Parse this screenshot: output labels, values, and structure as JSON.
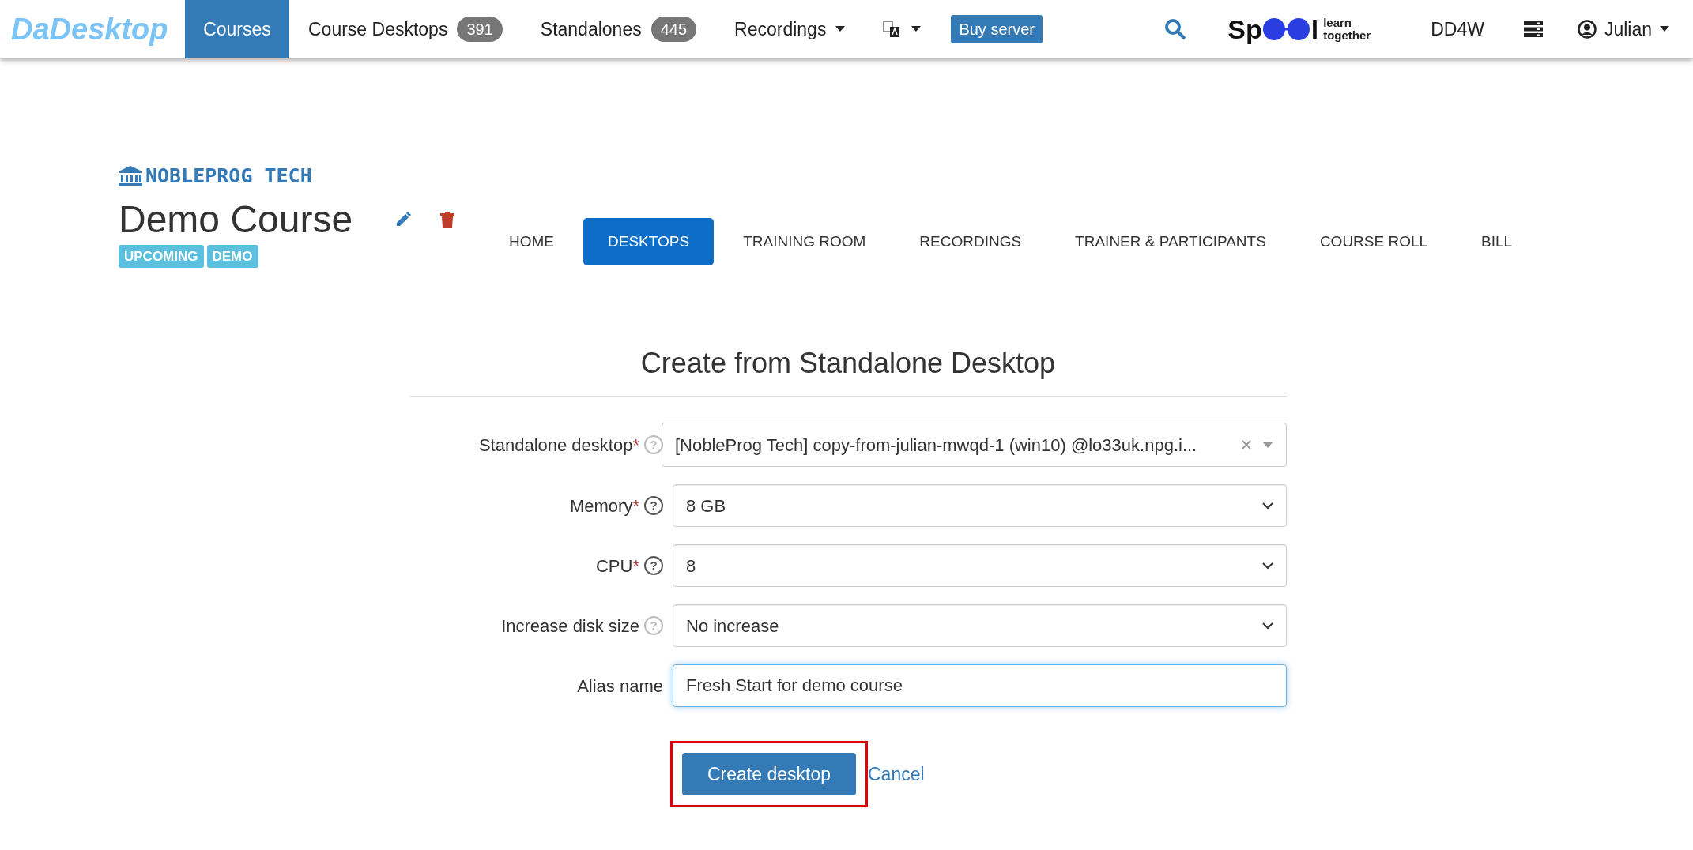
{
  "navbar": {
    "brand": "DaDesktop",
    "items": [
      {
        "kind": "link",
        "label": "Courses",
        "selected": true
      },
      {
        "kind": "link",
        "label": "Course Desktops",
        "badge": "391",
        "selected": false
      },
      {
        "kind": "link",
        "label": "Standalones",
        "badge": "445",
        "selected": false
      },
      {
        "kind": "dropdown",
        "label": "Recordings",
        "selected": false
      },
      {
        "kind": "language",
        "selected": false
      },
      {
        "kind": "button",
        "label": "Buy server"
      }
    ],
    "right": [
      {
        "kind": "search"
      },
      {
        "kind": "spool",
        "label": "Sp",
        "suffix": "l",
        "tagline": "learn together"
      },
      {
        "kind": "link",
        "label": "DD4W"
      },
      {
        "kind": "servers"
      },
      {
        "kind": "user",
        "label": "Julian"
      }
    ]
  },
  "course": {
    "organization": "NOBLEPROG TECH",
    "title": "Demo Course",
    "badges": [
      "UPCOMING",
      "DEMO"
    ],
    "tabs": [
      {
        "label": "HOME",
        "selected": false
      },
      {
        "label": "DESKTOPS",
        "selected": true
      },
      {
        "label": "TRAINING ROOM",
        "selected": false
      },
      {
        "label": "RECORDINGS",
        "selected": false
      },
      {
        "label": "TRAINER & PARTICIPANTS",
        "selected": false
      },
      {
        "label": "COURSE ROLL",
        "selected": false
      },
      {
        "label": "BILL",
        "selected": false
      }
    ]
  },
  "form": {
    "title": "Create from Standalone Desktop",
    "fields": [
      {
        "kind": "combobox",
        "label": "Standalone desktop",
        "required_mark": "*",
        "help": "?",
        "value": "[NobleProg Tech] copy-from-julian-mwqd-1 (win10) @lo33uk.npg.i..."
      },
      {
        "kind": "select",
        "label": "Memory",
        "required_mark": "*",
        "help": "?",
        "value": "8 GB"
      },
      {
        "kind": "select",
        "label": "CPU",
        "required_mark": "*",
        "help": "?",
        "value": "8"
      },
      {
        "kind": "select",
        "label": "Increase disk size",
        "help": "?",
        "value": "No increase"
      },
      {
        "kind": "text",
        "label": "Alias name",
        "value": "Fresh Start for demo course"
      }
    ],
    "submit": {
      "label": "Create desktop",
      "highlighted": true
    },
    "cancel": "Cancel"
  }
}
